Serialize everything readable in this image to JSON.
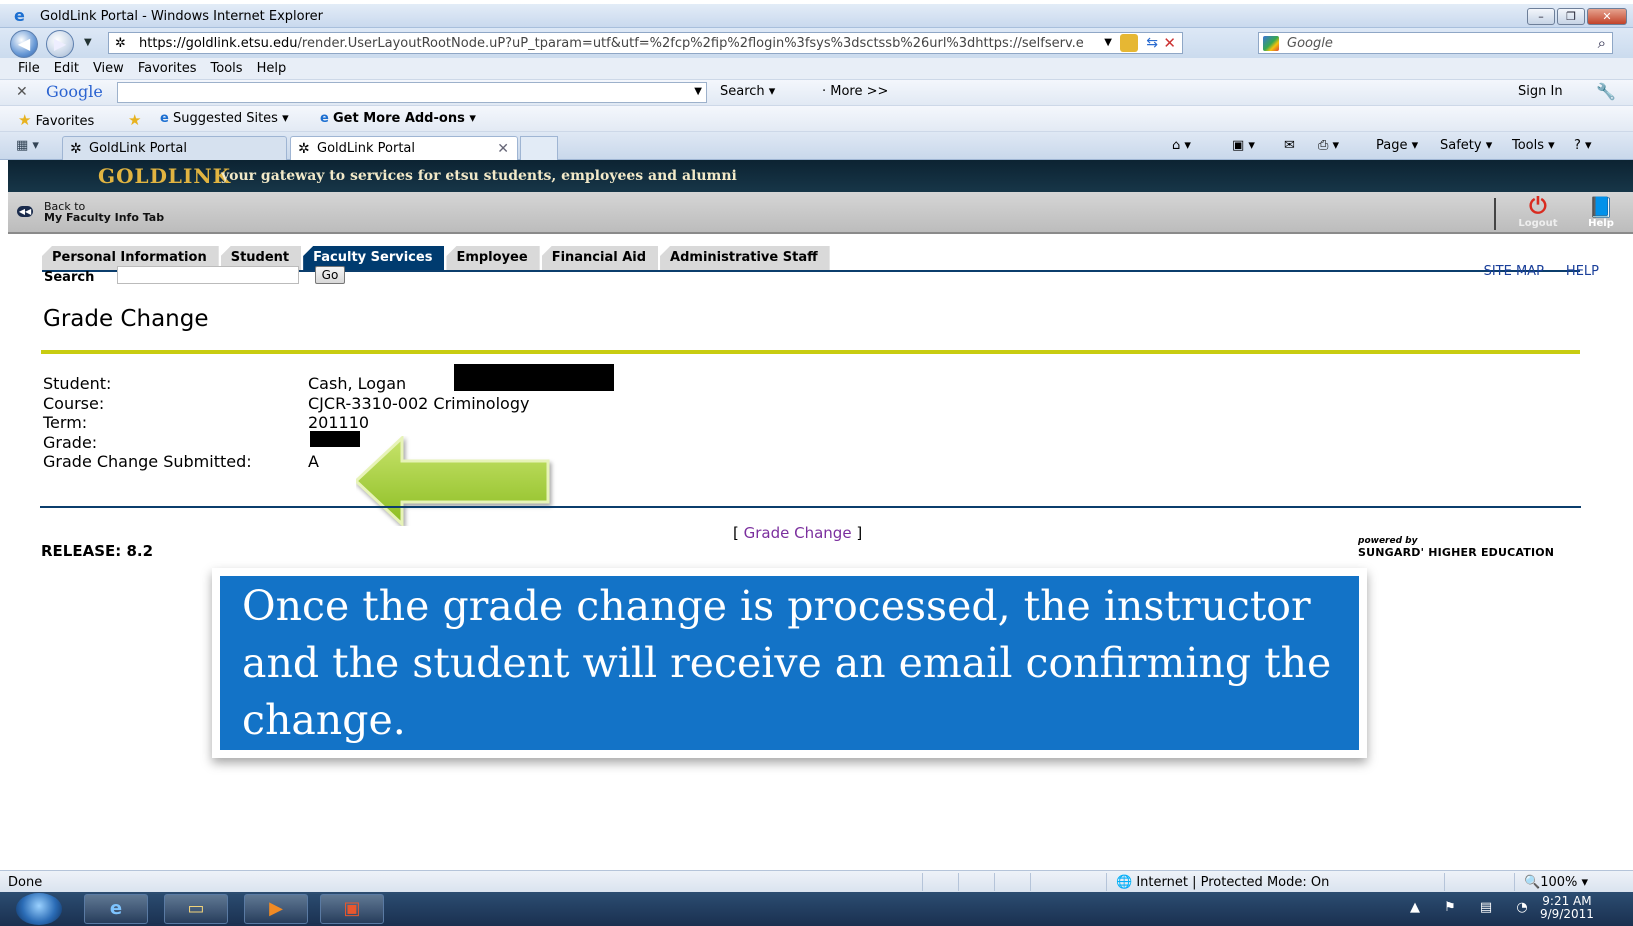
{
  "window": {
    "title": "GoldLink Portal - Windows Internet Explorer",
    "controls": [
      "–",
      "❐",
      "✕"
    ]
  },
  "address_bar": {
    "url_domain": "https://goldlink.etsu.edu",
    "url_path": "/render.UserLayoutRootNode.uP?uP_tparam=utf&utf=%2fcp%2fip%2flogin%3fsys%3dsctssb%26url%3dhttps://selfserv.e",
    "search_placeholder": "Google"
  },
  "menu_bar": [
    "File",
    "Edit",
    "View",
    "Favorites",
    "Tools",
    "Help"
  ],
  "google_toolbar": {
    "logo": "Google",
    "search_label": "Search ▾",
    "more_label": "· More >>",
    "sign_in": "Sign In"
  },
  "favorites_bar": {
    "favorites": "Favorites",
    "suggested_sites": "Suggested Sites ▾",
    "get_more_addons": "Get More Add-ons ▾"
  },
  "tabs": [
    {
      "label": "GoldLink Portal",
      "active": false
    },
    {
      "label": "GoldLink Portal",
      "active": true
    }
  ],
  "command_bar": {
    "page": "Page ▾",
    "safety": "Safety ▾",
    "tools": "Tools ▾"
  },
  "banner": {
    "brand": "GOLDLINK",
    "tagline": "your gateway to services for etsu students, employees and alumni"
  },
  "portal_nav": {
    "back_line1": "Back to",
    "back_line2": "My Faculty Info Tab",
    "logout": "Logout",
    "help": "Help"
  },
  "portal_tabs": [
    {
      "label": "Personal Information",
      "active": false
    },
    {
      "label": "Student",
      "active": false
    },
    {
      "label": "Faculty Services",
      "active": true
    },
    {
      "label": "Employee",
      "active": false
    },
    {
      "label": "Financial Aid",
      "active": false
    },
    {
      "label": "Administrative Staff",
      "active": false
    }
  ],
  "search": {
    "label": "Search",
    "go": "Go"
  },
  "top_links": {
    "site_map": "SITE MAP",
    "help": "HELP"
  },
  "page_title": "Grade Change",
  "details": [
    {
      "label": "Student:",
      "value": "Cash, Logan"
    },
    {
      "label": "Course:",
      "value": "CJCR-3310-002 Criminology"
    },
    {
      "label": "Term:",
      "value": "201110"
    },
    {
      "label": "Grade:",
      "value": ""
    },
    {
      "label": "Grade Change Submitted:",
      "value": "A"
    }
  ],
  "footer": {
    "link_open": "[ ",
    "link_text": "Grade Change",
    "link_close": " ]",
    "release": "RELEASE: 8.2",
    "powered_by": "powered by",
    "sungard": "SUNGARD' HIGHER EDUCATION"
  },
  "callout": {
    "text": "Once the grade change is processed, the instructor and the student will receive an email confirming the change."
  },
  "status_bar": {
    "left": "Done",
    "zone": "Internet | Protected Mode: On",
    "zoom": "100%"
  },
  "taskbar": {
    "time": "9:21 AM",
    "date": "9/9/2011"
  },
  "colors": {
    "banner_gold": "#e1b441",
    "tab_active": "#003b6f",
    "rule_yellow": "#c8cc11",
    "callout_blue": "#1373c7",
    "arrow_green": "#a7d23d"
  }
}
